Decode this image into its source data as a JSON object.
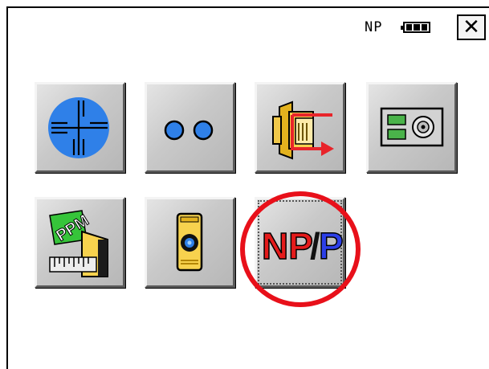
{
  "status": {
    "mode_text": "NP",
    "battery": "battery-full-icon",
    "close_label": "✕"
  },
  "tiles": [
    {
      "name": "observation-target",
      "icon": "crosshair-icon"
    },
    {
      "name": "dual-circles",
      "icon": "two-circles-icon"
    },
    {
      "name": "data-output",
      "icon": "output-arrow-icon"
    },
    {
      "name": "memory-card",
      "icon": "card-disc-icon"
    },
    {
      "name": "ppm-settings",
      "icon": "ppm-ruler-icon"
    },
    {
      "name": "prism-target",
      "icon": "prism-icon"
    },
    {
      "name": "np-p-toggle",
      "icon": "np-p-icon",
      "label_np": "NP",
      "label_slash": "/",
      "label_p": "P"
    }
  ],
  "colors": {
    "highlight": "#e8101a",
    "np_red": "#e41b1b",
    "p_blue": "#2c3fe8",
    "target_blue": "#2f80e8"
  }
}
